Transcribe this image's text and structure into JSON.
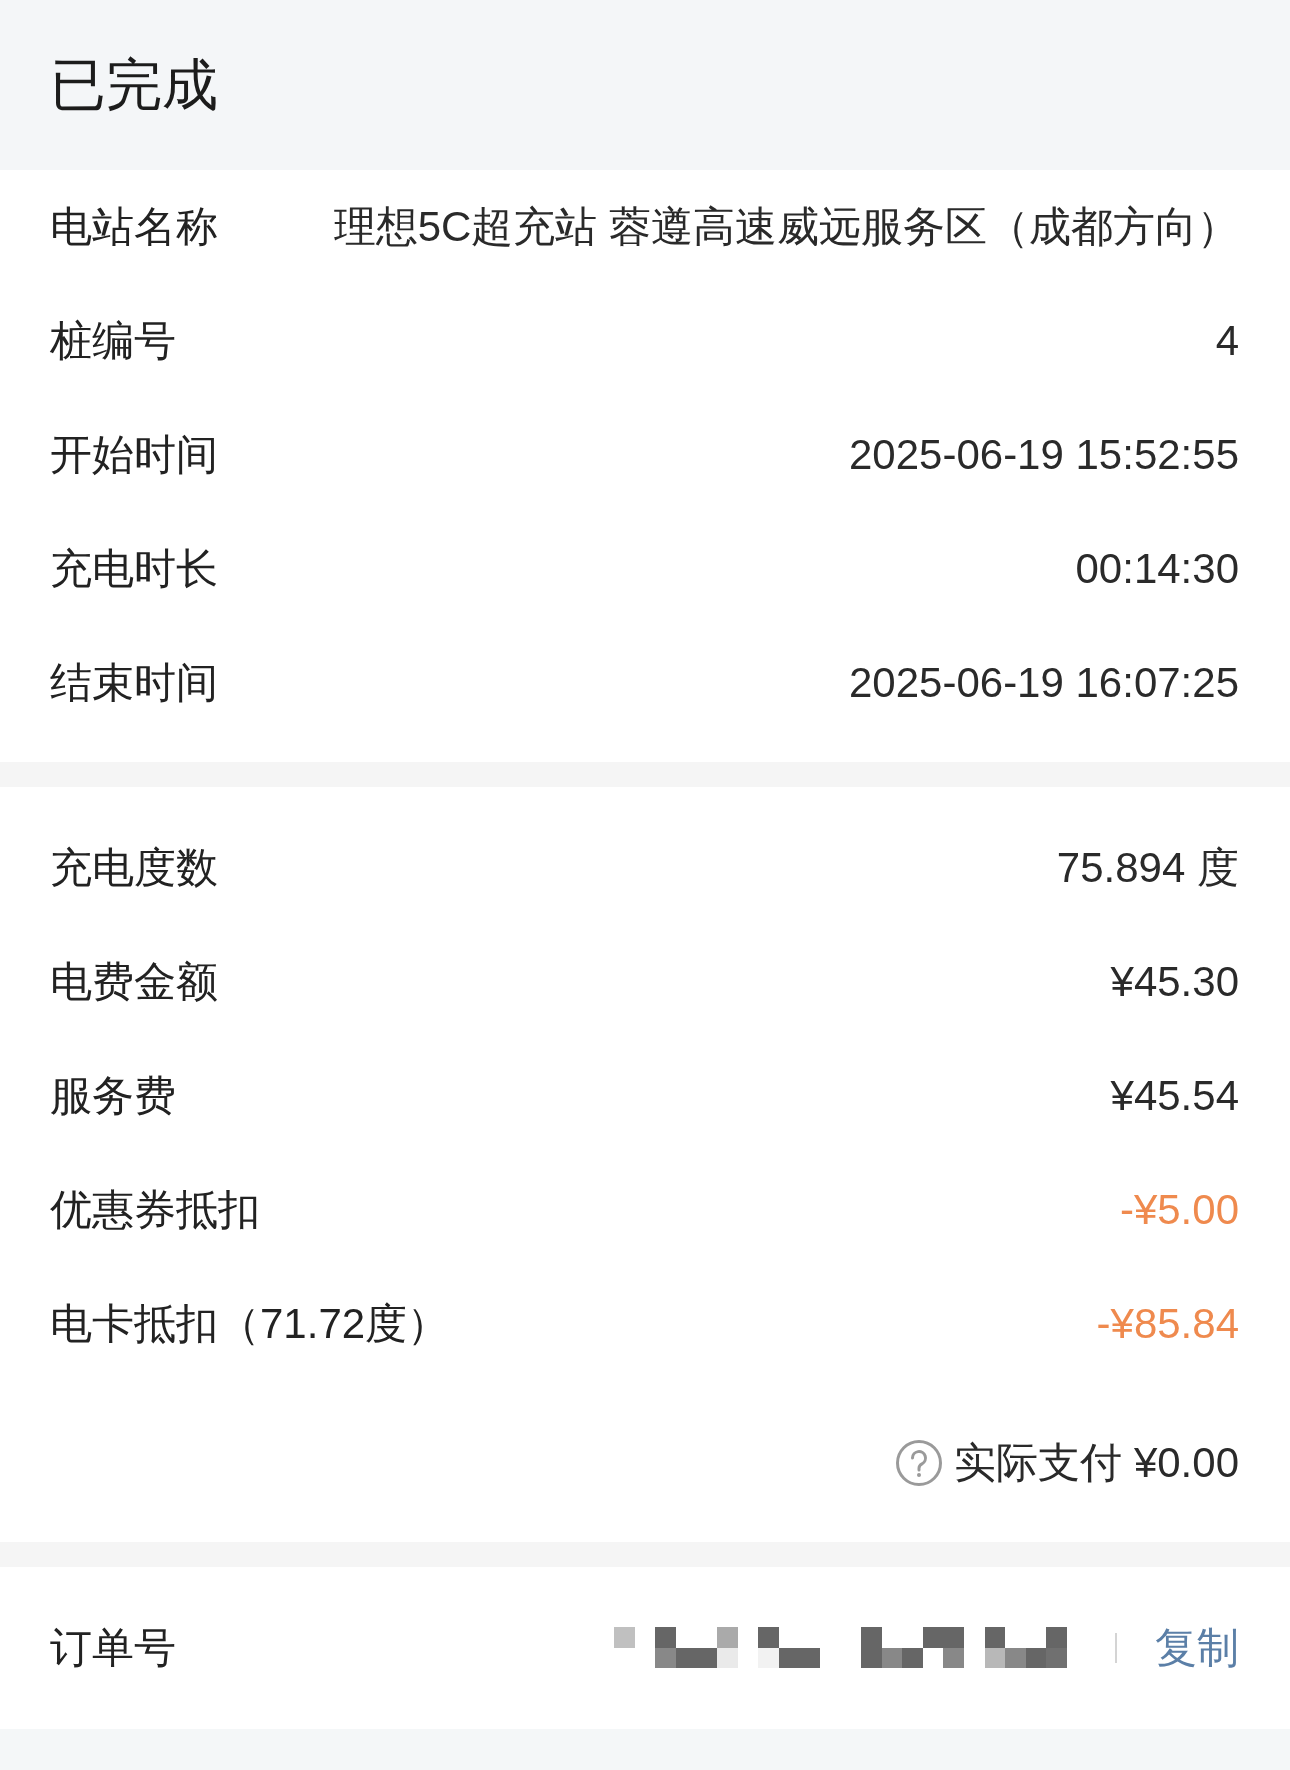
{
  "header": {
    "status": "已完成"
  },
  "details": [
    {
      "label": "电站名称",
      "value": "理想5C超充站 蓉遵高速威远服务区（成都方向）"
    },
    {
      "label": "桩编号",
      "value": "4"
    },
    {
      "label": "开始时间",
      "value": "2025-06-19 15:52:55"
    },
    {
      "label": "充电时长",
      "value": "00:14:30"
    },
    {
      "label": "结束时间",
      "value": "2025-06-19 16:07:25"
    }
  ],
  "charges": [
    {
      "label": "充电度数",
      "value": "75.894 度",
      "kind": "amount"
    },
    {
      "label": "电费金额",
      "value": "¥45.30",
      "kind": "amount"
    },
    {
      "label": "服务费",
      "value": "¥45.54",
      "kind": "amount"
    },
    {
      "label": "优惠券抵扣",
      "value": "-¥5.00",
      "kind": "deduction"
    },
    {
      "label": "电卡抵扣（71.72度）",
      "value": "-¥85.84",
      "kind": "deduction"
    }
  ],
  "total": {
    "text": "实际支付 ¥0.00"
  },
  "order": {
    "label": "订单号",
    "copy_button": "复制"
  }
}
